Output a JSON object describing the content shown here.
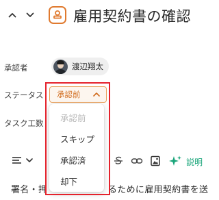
{
  "header": {
    "title": "雇用契約書の確認",
    "prev_icon": "chevron-up-icon",
    "next_icon": "chevron-down-icon",
    "title_icon": "stamp-icon",
    "accent_color": "#e07a2f"
  },
  "fields": {
    "approver": {
      "label": "承認者",
      "user_name": "渡辺翔太"
    },
    "status": {
      "label": "ステータス",
      "value": "承認前",
      "color": "#d26f22"
    },
    "task_effort": {
      "label": "タスク工数"
    }
  },
  "status_dropdown": {
    "options": [
      {
        "label": "承認前",
        "disabled": true
      },
      {
        "label": "スキップ",
        "disabled": false
      },
      {
        "label": "承認済",
        "disabled": false
      },
      {
        "label": "却下",
        "disabled": false
      }
    ]
  },
  "toolbar": {
    "ai_label": "説明",
    "ai_color": "#1aa57a"
  },
  "editor": {
    "body_left": "署名・押",
    "body_right": "るために雇用契約書を送"
  },
  "highlight_color": "#e5222c"
}
